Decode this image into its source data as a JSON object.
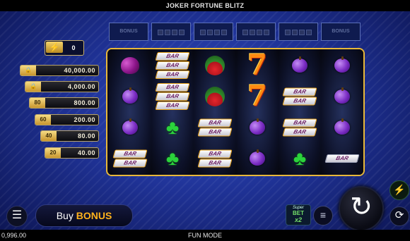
{
  "header": {
    "title": "JOKER FORTUNE BLITZ"
  },
  "footer": {
    "balance": "0,996.00",
    "mode": "FUN MODE"
  },
  "meters": [
    {
      "label": "BONUS"
    },
    {
      "label": ""
    },
    {
      "label": ""
    },
    {
      "label": ""
    },
    {
      "label": ""
    },
    {
      "label": "BONUS"
    }
  ],
  "bolt_counter": {
    "icon": "lightning-icon",
    "value": "0"
  },
  "jackpots": [
    {
      "tag": "lock-icon",
      "tag_text": "🔒",
      "amount": "40,000.00"
    },
    {
      "tag": "lock-icon",
      "tag_text": "🔒",
      "amount": "4,000.00"
    },
    {
      "tag": "multiplier",
      "tag_text": "80",
      "amount": "800.00"
    },
    {
      "tag": "multiplier",
      "tag_text": "60",
      "amount": "200.00"
    },
    {
      "tag": "multiplier",
      "tag_text": "40",
      "amount": "80.00"
    },
    {
      "tag": "multiplier",
      "tag_text": "20",
      "amount": "40.00"
    }
  ],
  "reels": [
    [
      "grapes",
      "plum",
      "plum",
      "bar2"
    ],
    [
      "bar3",
      "bar3",
      "clover",
      "clover"
    ],
    [
      "melon",
      "melon",
      "bar2",
      "bar2"
    ],
    [
      "seven",
      "seven",
      "plum",
      "plum"
    ],
    [
      "plum",
      "bar2",
      "bar2",
      "clover"
    ],
    [
      "plum",
      "plum",
      "plum",
      "bar1"
    ]
  ],
  "bar_text": "BAR",
  "controls": {
    "menu_icon": "☰",
    "buy_bonus_1": "Buy ",
    "buy_bonus_2": "BONUS",
    "super_bet_1": "Super",
    "super_bet_2": "BET",
    "super_bet_3": "x2",
    "coin_icon": "≡",
    "spin_icon": "↻",
    "turbo_icon": "⚡",
    "autoplay_icon": "⟳"
  }
}
